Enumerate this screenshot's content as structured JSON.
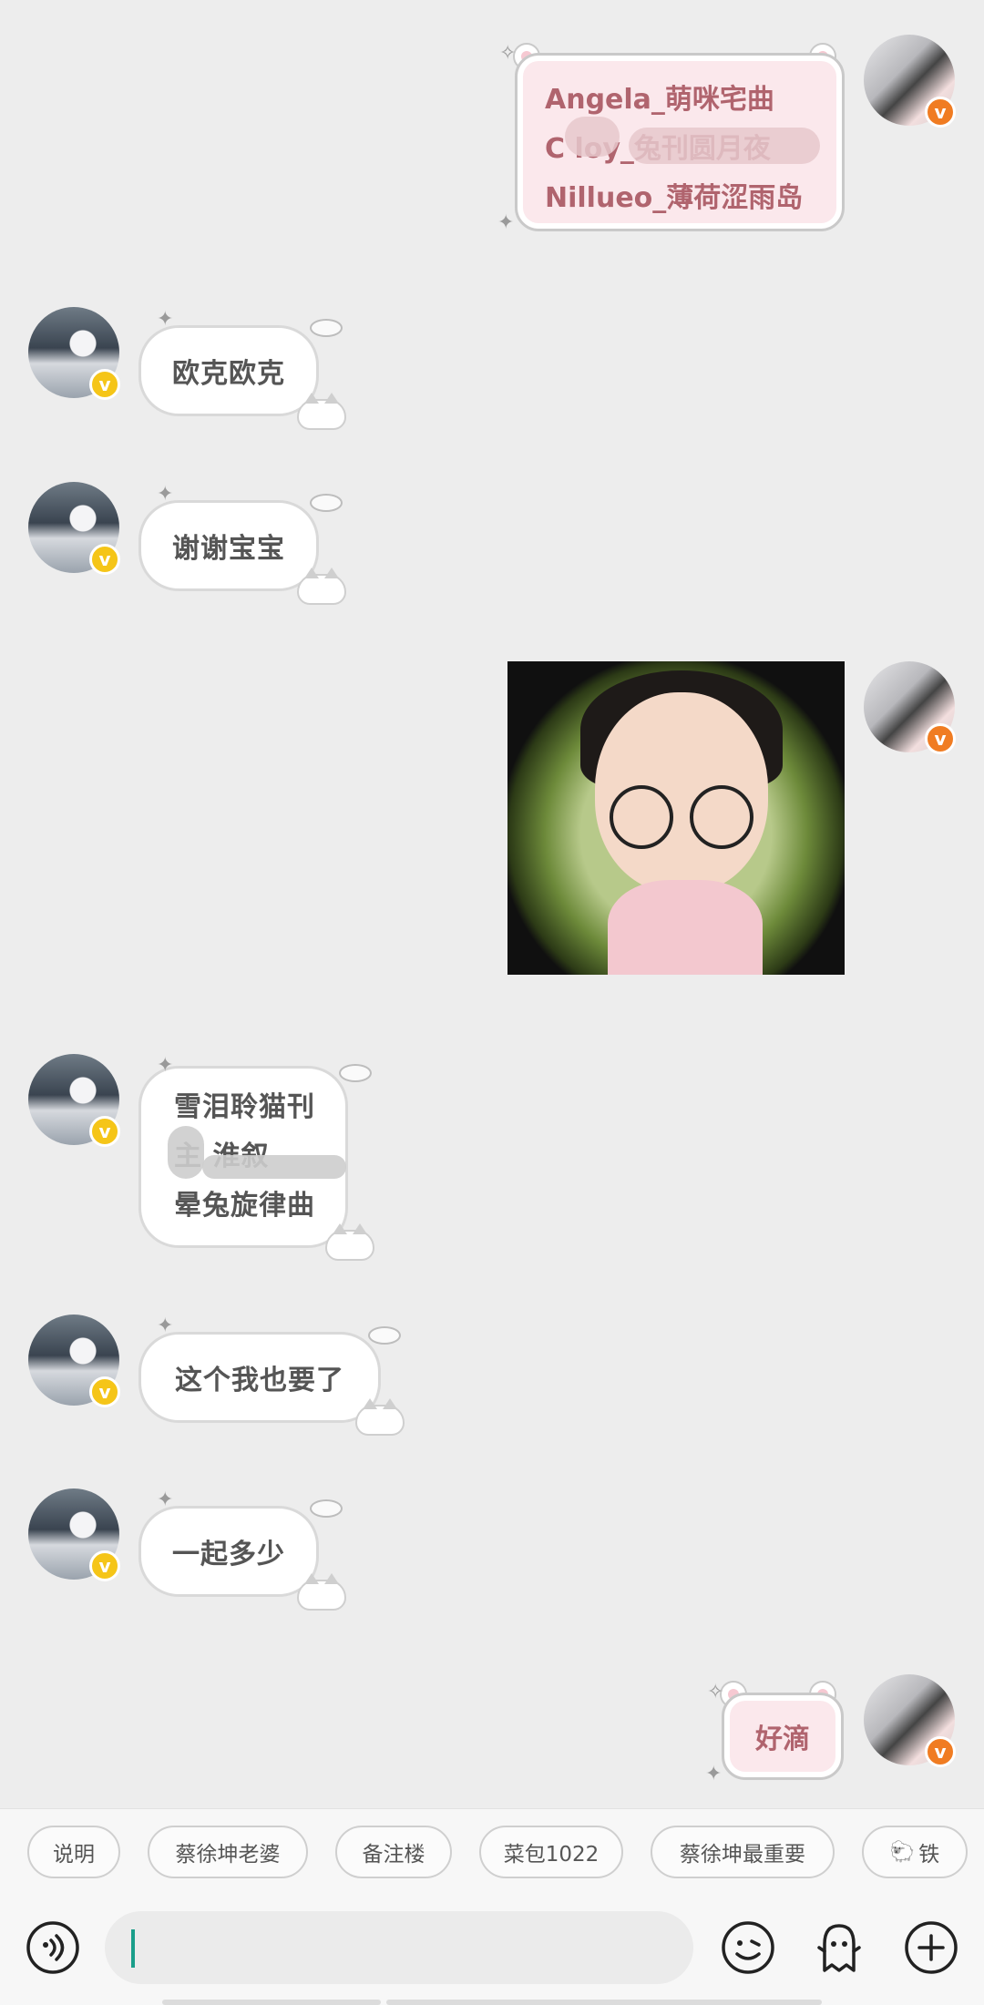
{
  "messages": {
    "m1_lines": [
      "Angela_萌咪宅曲",
      "C    loy_兔刊圆月夜",
      "Nillueo_薄荷涩雨岛"
    ],
    "m2": "欧克欧克",
    "m3": "谢谢宝宝",
    "m5_lines": [
      "雪泪聆猫刊",
      "  主  淮叙",
      "晕兔旋律曲"
    ],
    "m6": "这个我也要了",
    "m7": "一起多少",
    "m8": "好滴"
  },
  "badge_glyph": "v",
  "quick_replies": [
    "说明",
    "蔡徐坤老婆",
    "备注楼",
    "菜包1022",
    "蔡徐坤最重要",
    "铁"
  ],
  "input": {
    "value": ""
  },
  "icons": [
    "voice-icon",
    "emoji-icon",
    "sticker-icon",
    "plus-icon"
  ],
  "colors": {
    "background": "#ededed",
    "pink_bubble": "#fbe8ec",
    "cursor": "#1a9e8a",
    "badge_gold": "#f5c518",
    "badge_orange": "#f07c22"
  }
}
